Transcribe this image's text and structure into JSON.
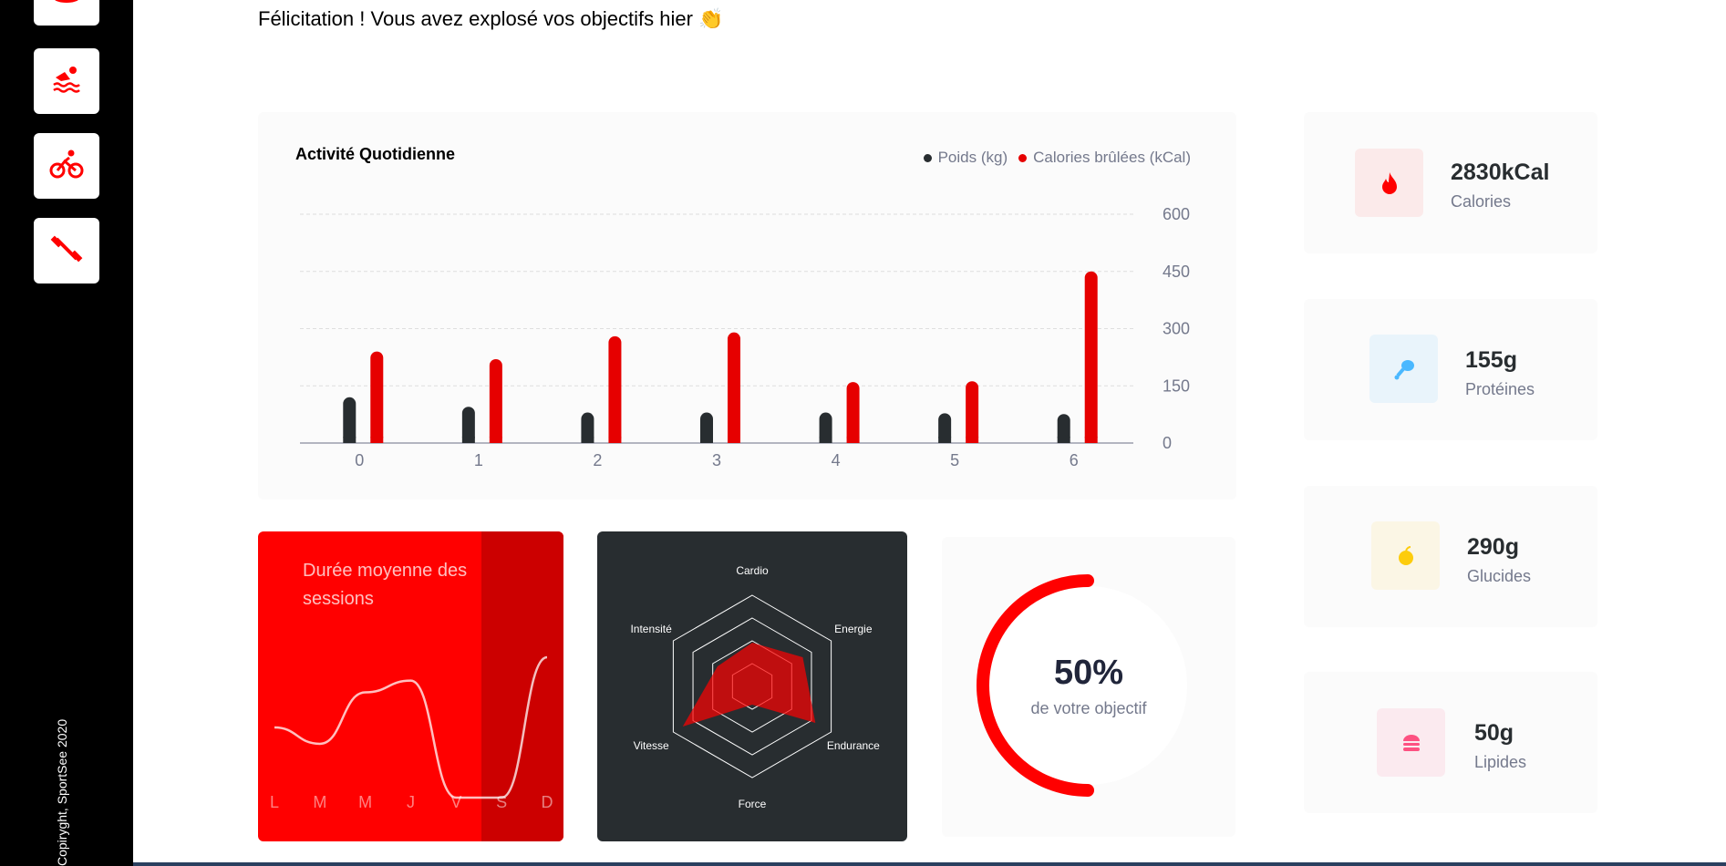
{
  "greeting": "Félicitation ! Vous avez explosé vos objectifs hier 👏",
  "sidebar": {
    "icons": [
      "yoga-icon",
      "swimming-icon",
      "cycling-icon",
      "dumbbell-icon"
    ],
    "copyright": "Copiryght, SportSee 2020"
  },
  "colors": {
    "accent": "#ff0000",
    "dark": "#282d30",
    "weight": "#282d30"
  },
  "activity": {
    "title": "Activité Quotidienne",
    "legend_weight": "Poids (kg)",
    "legend_calories": "Calories brûlées (kCal)"
  },
  "duration": {
    "title": "Durée moyenne des sessions"
  },
  "score": {
    "value": "50%",
    "label": "de votre objectif"
  },
  "key_data": [
    {
      "icon": "flame-icon",
      "value": "2830kCal",
      "label": "Calories"
    },
    {
      "icon": "chicken-leg-icon",
      "value": "155g",
      "label": "Protéines"
    },
    {
      "icon": "apple-icon",
      "value": "290g",
      "label": "Glucides"
    },
    {
      "icon": "burger-icon",
      "value": "50g",
      "label": "Lipides"
    }
  ],
  "chart_data": [
    {
      "type": "bar",
      "title": "Activité Quotidienne",
      "categories": [
        "0",
        "1",
        "2",
        "3",
        "4",
        "5",
        "6"
      ],
      "series": [
        {
          "name": "Poids (kg)",
          "values": [
            120,
            95,
            80,
            80,
            80,
            78,
            76
          ]
        },
        {
          "name": "Calories brûlées (kCal)",
          "values": [
            240,
            220,
            280,
            290,
            160,
            162,
            450
          ]
        }
      ],
      "y_ticks": [
        "0",
        "150",
        "300",
        "450",
        "600"
      ],
      "ylim": [
        0,
        600
      ],
      "grid": true,
      "legend": "top-right"
    },
    {
      "type": "line",
      "title": "Durée moyenne des sessions",
      "categories": [
        "L",
        "M",
        "M",
        "J",
        "V",
        "S",
        "D"
      ],
      "values": [
        30,
        23,
        45,
        50,
        0,
        0,
        60
      ]
    },
    {
      "type": "radar",
      "axes": [
        "Cardio",
        "Energie",
        "Endurance",
        "Force",
        "Vitesse",
        "Intensité"
      ],
      "values": [
        120,
        160,
        200,
        50,
        220,
        110
      ],
      "max": 250
    },
    {
      "type": "pie",
      "values": [
        0.5
      ],
      "label": "50%",
      "sublabel": "de votre objectif"
    }
  ]
}
